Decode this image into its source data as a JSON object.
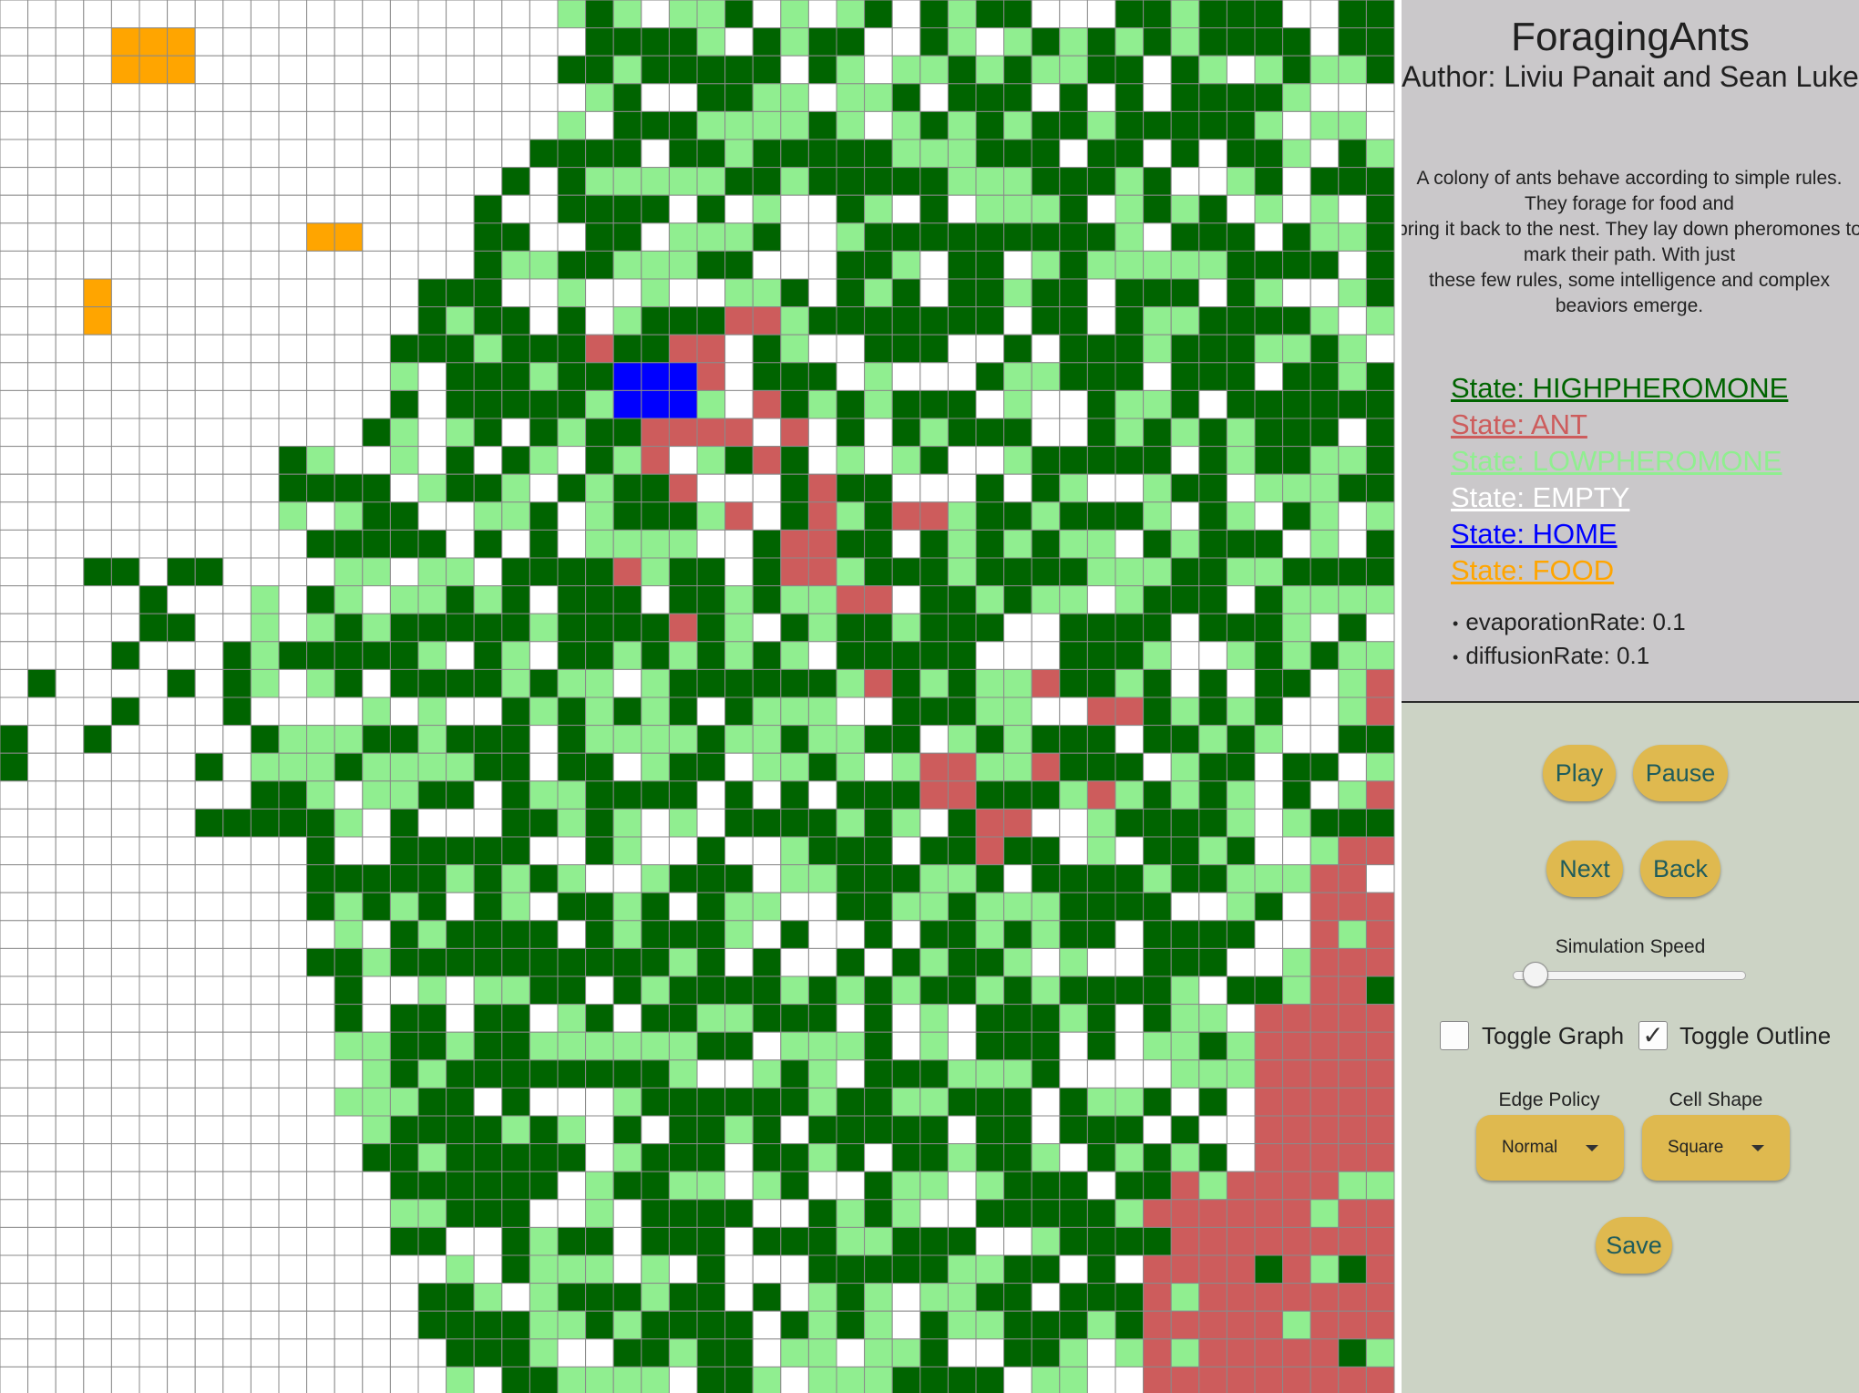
{
  "app": {
    "title": "ForagingAnts",
    "author": "Author: Liviu Panait and Sean Luke",
    "description": "A colony of ants behave according to simple rules. They forage for food and\nbring it back to the nest. They lay down pheromones to mark their path. With just\nthese few rules, some intelligence and complex beaviors emerge."
  },
  "legend": [
    {
      "label": "State: HIGHPHEROMONE",
      "color": "#006400"
    },
    {
      "label": "State: ANT",
      "color": "#cd5c5c"
    },
    {
      "label": "State: LOWPHEROMONE",
      "color": "#90ee90"
    },
    {
      "label": "State: EMPTY",
      "color": "#ffffff"
    },
    {
      "label": "State: HOME",
      "color": "#0000ff"
    },
    {
      "label": "State: FOOD",
      "color": "#ffa500"
    }
  ],
  "parameters": [
    {
      "text": "evaporationRate: 0.1"
    },
    {
      "text": "diffusionRate: 0.1"
    }
  ],
  "controls": {
    "play": "Play",
    "pause": "Pause",
    "next": "Next",
    "back": "Back",
    "speed_label": "Simulation Speed",
    "speed_value": 0.05,
    "toggle_graph": {
      "label": "Toggle Graph",
      "checked": false
    },
    "toggle_outline": {
      "label": "Toggle Outline",
      "checked": true
    },
    "edge_policy": {
      "label": "Edge Policy",
      "value": "Normal"
    },
    "cell_shape": {
      "label": "Cell Shape",
      "value": "Square"
    },
    "save": "Save"
  },
  "grid": {
    "columns": 50,
    "rows": 50,
    "outline_color": "#8a8a8a",
    "state_colors": {
      "0": "#ffffff",
      "1": "#006400",
      "2": "#90ee90",
      "3": "#cd5c5c",
      "4": "#0000ff",
      "5": "#ffa500"
    }
  }
}
